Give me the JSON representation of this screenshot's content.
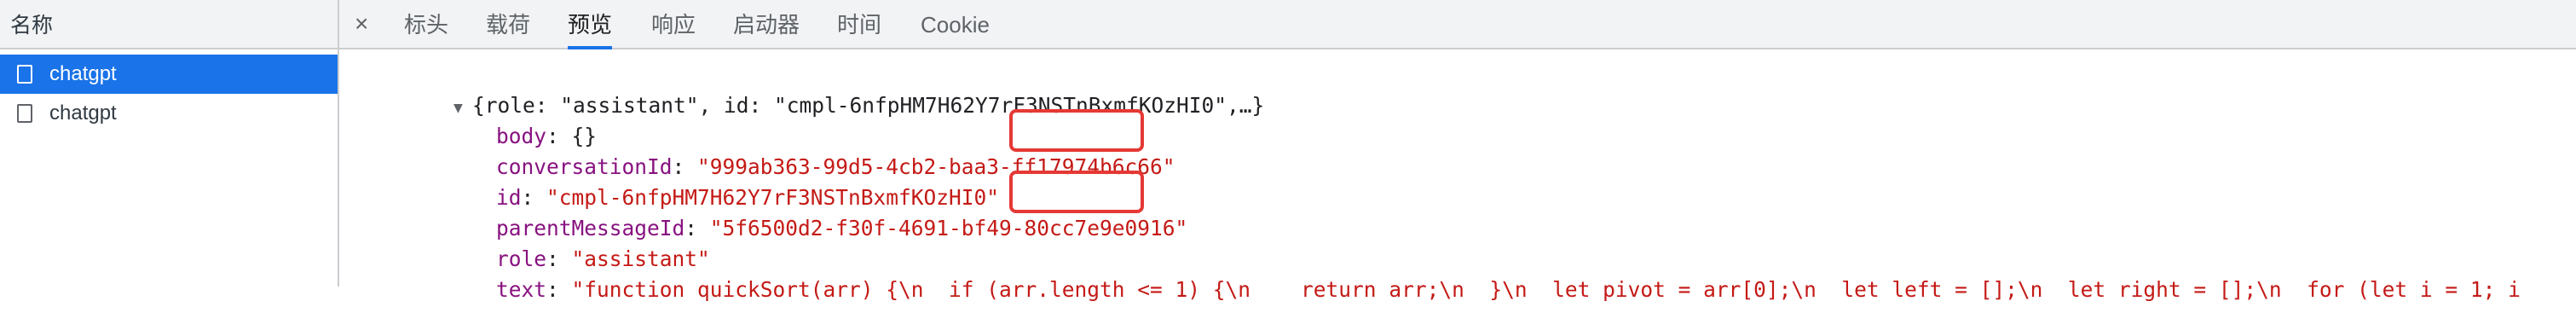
{
  "left_panel": {
    "header": "名称",
    "requests": [
      {
        "name": "chatgpt",
        "selected": true
      },
      {
        "name": "chatgpt",
        "selected": false
      }
    ]
  },
  "tabbar": {
    "close": "×",
    "tabs": [
      "标头",
      "载荷",
      "预览",
      "响应",
      "启动器",
      "时间",
      "Cookie"
    ],
    "active_tab": "预览"
  },
  "preview": {
    "summary": "{role: \"assistant\", id: \"cmpl-6nfpHM7H62Y7rF3NSTnBxmfKOzHI0\",…}",
    "fields": [
      {
        "key": "body",
        "value": "{}"
      },
      {
        "key": "conversationId",
        "value": "\"999ab363-99d5-4cb2-baa3-ff17974b6c66\""
      },
      {
        "key": "id",
        "value": "\"cmpl-6nfpHM7H62Y7rF3NSTnBxmfKOzHI0\""
      },
      {
        "key": "parentMessageId",
        "value": "\"5f6500d2-f30f-4691-bf49-80cc7e9e0916\""
      },
      {
        "key": "role",
        "value": "\"assistant\""
      },
      {
        "key": "text",
        "value": "\"function quickSort(arr) {\\n  if (arr.length <= 1) {\\n    return arr;\\n  }\\n  let pivot = arr[0];\\n  let left = [];\\n  let right = [];\\n  for (let i = 1; i"
      }
    ]
  },
  "colors": {
    "accent": "#1a73e8",
    "json_key": "#881280",
    "json_string": "#c41a16",
    "highlight": "#e53935"
  }
}
